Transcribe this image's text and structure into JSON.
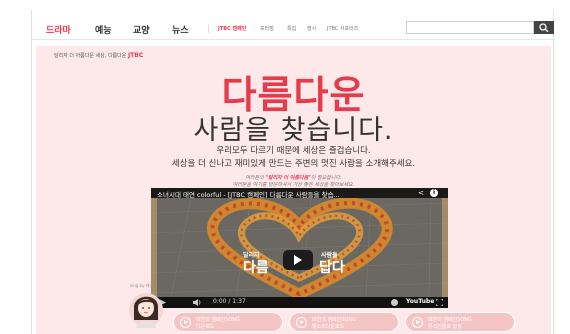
{
  "nav": {
    "items": [
      "드라마",
      "예능",
      "교양",
      "뉴스"
    ],
    "active_index": 0,
    "sub_items": [
      "JTBC 캠페인",
      "포터벌",
      "특집",
      "행사",
      "JTBC 서포터즈"
    ],
    "active_sub_index": 0,
    "search_placeholder": "",
    "colors": {
      "accent": "#e8384f",
      "search_button": "#444444"
    }
  },
  "panel": {
    "header_text": "달리자 더 아름다운 세상, 다름다운",
    "header_logo": "JTBC",
    "title_main": "다름다운",
    "title_sub": "사람을 찾습니다.",
    "desc_line1": "우리모두 다르기 때문에 세상은 즐겁습니다.",
    "desc_line2": "세상을  더 신나고 재미있게 만드는 주변의 멋진 사람을 소개해주세요.",
    "hand_line1_pre": "여러분의 ",
    "hand_line1_highlight": "\"달리자 더 아름다움\"",
    "hand_line1_post": "이 필요합니다.",
    "hand_line2": "여러분을 여기를 방문하셔서 가장 좋은 세상을 찾아보세요.",
    "colors": {
      "background": "#fde9e9",
      "title": "#e43c4d"
    }
  },
  "video": {
    "title": "소녀시대 태연 colorful - [JTBC 캠페인] 다름다운 사람들을 찾습...",
    "caption_small_left": "달리자",
    "caption_small_right": "사람들",
    "caption_big_left": "다름",
    "caption_big_right": "답다",
    "time": "0:00 / 1:37",
    "logo": "YouTube"
  },
  "avatar": {
    "tag": "sing by 태연",
    "icon": "avatar-illustration"
  },
  "buttons": [
    {
      "line1": "태연의 캠페인SONG",
      "line2": "다운로드"
    },
    {
      "line1": "태연의 캠페인SONG",
      "line2": "벨소리다운로드"
    },
    {
      "line1": "태연의 캠페인SONG",
      "line2": "뮤직인클로 설정"
    }
  ]
}
